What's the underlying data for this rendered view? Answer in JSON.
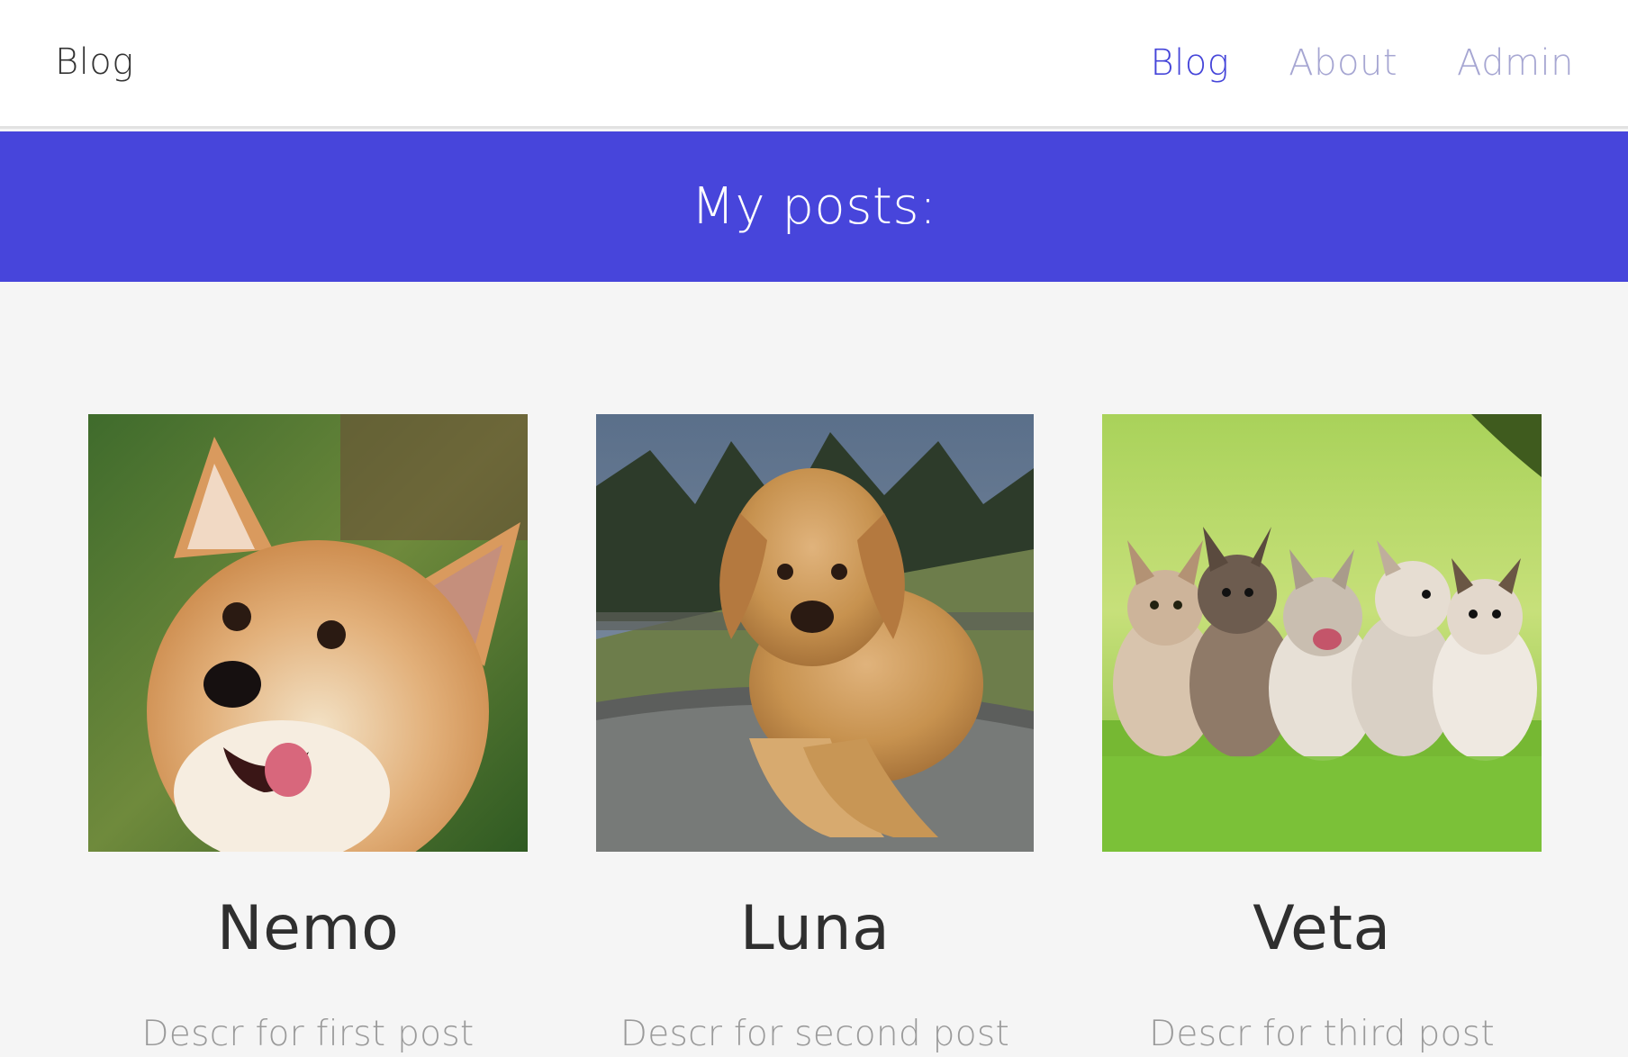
{
  "header": {
    "brand": "Blog",
    "nav": [
      {
        "label": "Blog",
        "active": true
      },
      {
        "label": "About",
        "active": false
      },
      {
        "label": "Admin",
        "active": false
      }
    ]
  },
  "hero": {
    "title": "My posts:",
    "color": "#4745db"
  },
  "posts": [
    {
      "title": "Nemo",
      "description": "Descr for first post",
      "image": "corgi-photo"
    },
    {
      "title": "Luna",
      "description": "Descr for second post",
      "image": "golden-retriever-photo"
    },
    {
      "title": "Veta",
      "description": "Descr for third post",
      "image": "puppies-photo"
    }
  ],
  "colors": {
    "nav_active": "#4545d9",
    "nav_inactive": "#a6a6d2",
    "background": "#f5f5f5"
  }
}
